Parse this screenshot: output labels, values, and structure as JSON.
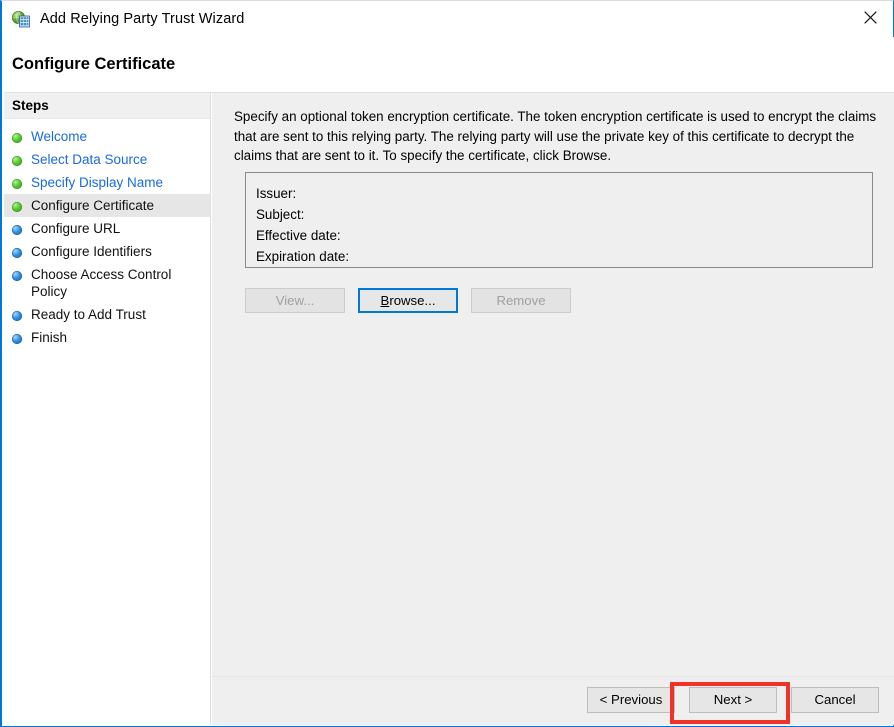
{
  "window": {
    "title": "Add Relying Party Trust Wizard",
    "icon": "relying-party-globe-icon",
    "close_label": "close-icon",
    "accent_color": "#0078d7",
    "highlight_color": "#f03228"
  },
  "page": {
    "title": "Configure Certificate"
  },
  "sidebar": {
    "header": "Steps",
    "items": [
      {
        "label": "Welcome",
        "state": "done",
        "style": "link"
      },
      {
        "label": "Select Data Source",
        "state": "done",
        "style": "link"
      },
      {
        "label": "Specify Display Name",
        "state": "done",
        "style": "link"
      },
      {
        "label": "Configure Certificate",
        "state": "done",
        "style": "current"
      },
      {
        "label": "Configure URL",
        "state": "pending",
        "style": "plain"
      },
      {
        "label": "Configure Identifiers",
        "state": "pending",
        "style": "plain"
      },
      {
        "label": "Choose Access Control Policy",
        "state": "pending",
        "style": "plain"
      },
      {
        "label": "Ready to Add Trust",
        "state": "pending",
        "style": "plain"
      },
      {
        "label": "Finish",
        "state": "pending",
        "style": "plain"
      }
    ]
  },
  "main": {
    "intro": "Specify an optional token encryption certificate.  The token encryption certificate is used to encrypt the claims that are sent to this relying party.  The relying party will use the private key of this certificate to decrypt the claims that are sent to it.  To specify the certificate, click Browse.",
    "certificate": {
      "issuer_label": "Issuer:",
      "issuer_value": "",
      "subject_label": "Subject:",
      "subject_value": "",
      "effective_date_label": "Effective date:",
      "effective_date_value": "",
      "expiration_date_label": "Expiration date:",
      "expiration_date_value": ""
    },
    "buttons": {
      "view": "View...",
      "browse_accel": "B",
      "browse_rest": "rowse...",
      "remove": "Remove"
    }
  },
  "footer": {
    "previous": "< Previous",
    "next": "Next >",
    "cancel": "Cancel"
  }
}
